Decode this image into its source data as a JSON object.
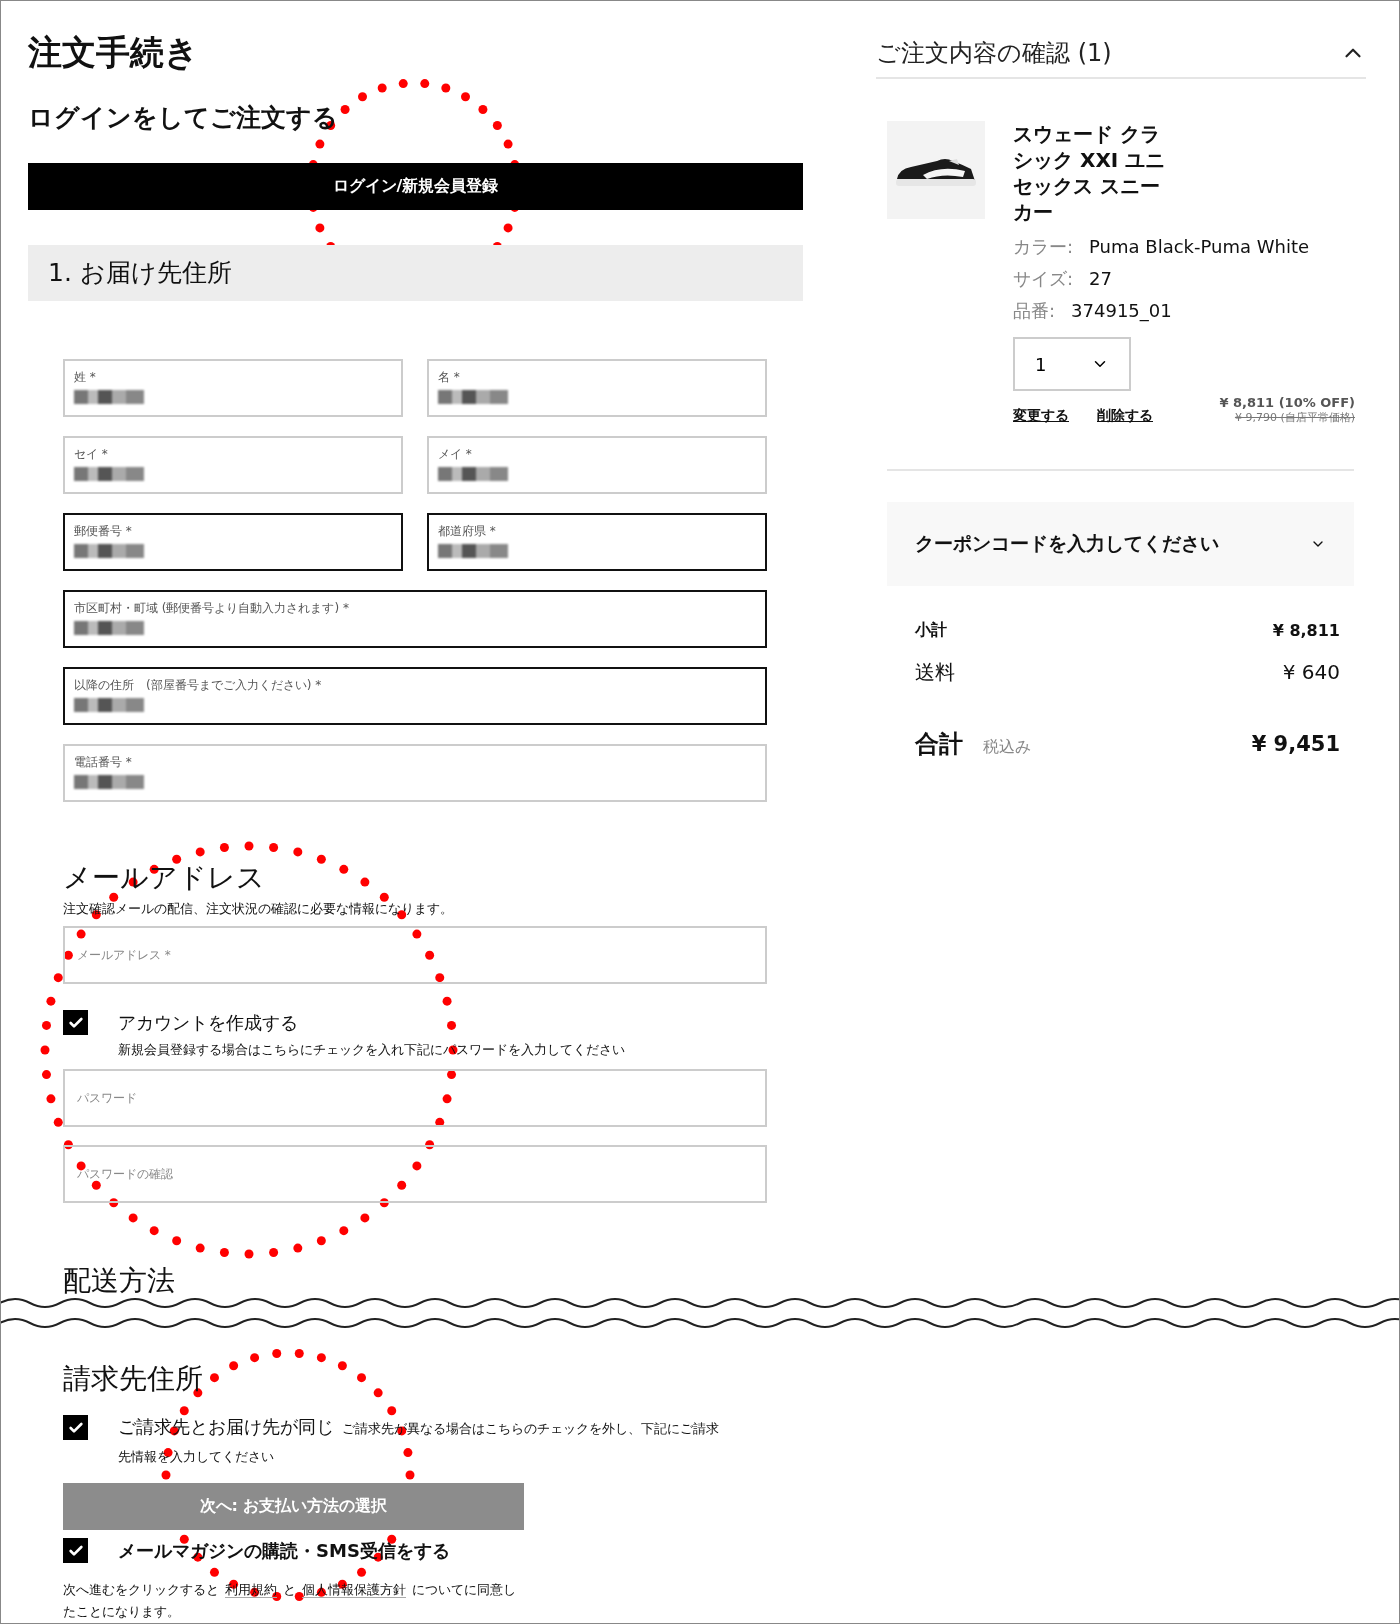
{
  "page_title": "注文手続き",
  "login": {
    "heading": "ログインをしてご注文する",
    "button": "ログイン/新規会員登録"
  },
  "shipping_address": {
    "heading": "1. お届け先住所",
    "fields": [
      {
        "label": "姓 *",
        "kind": "half",
        "outlined": false,
        "value_blurred": true
      },
      {
        "label": "名 *",
        "kind": "half",
        "outlined": false,
        "value_blurred": true
      },
      {
        "label": "セイ *",
        "kind": "half",
        "outlined": false,
        "value_blurred": true
      },
      {
        "label": "メイ *",
        "kind": "half",
        "outlined": false,
        "value_blurred": true
      },
      {
        "label": "郵便番号 *",
        "kind": "half",
        "outlined": true,
        "value_blurred": true
      },
      {
        "label": "都道府県 *",
        "kind": "half",
        "outlined": true,
        "value_blurred": true
      },
      {
        "label": "市区町村・町域 (郵便番号より自動入力されます) *",
        "kind": "full",
        "outlined": true,
        "value_blurred": true
      },
      {
        "label": "以降の住所　(部屋番号までご入力ください) *",
        "kind": "full",
        "outlined": true,
        "value_blurred": true
      },
      {
        "label": "電話番号 *",
        "kind": "full",
        "outlined": false,
        "value_blurred": true
      }
    ]
  },
  "email": {
    "heading": "メールアドレス",
    "note": "注文確認メールの配信、注文状況の確認に必要な情報になります。",
    "field": {
      "placeholder": "メールアドレス *"
    },
    "create_account": {
      "label": "アカウントを作成する",
      "checked": true,
      "hint": "新規会員登録する場合はこちらにチェックを入れ下記にパスワードを入力してください"
    },
    "password": {
      "placeholder": "パスワード"
    },
    "password_confirm": {
      "placeholder": "パスワードの確認"
    }
  },
  "shipping_method": {
    "heading": "配送方法"
  },
  "billing": {
    "heading": "請求先住所",
    "same_address": {
      "label": "ご請求先とお届け先が同じ",
      "checked": true,
      "hint_lines": [
        "ご請求先が異なる場合はこちらのチェックを外し、下記にご請求",
        "先情報を入力してください"
      ]
    },
    "next_button": {
      "label": "次へ: お支払い方法の選択",
      "disabled": true
    },
    "newsletter": {
      "label": "メールマガジンの購読・SMS受信をする",
      "checked": true
    },
    "terms": [
      {
        "kind": "text",
        "text": "次へ進むをクリックすると"
      },
      {
        "kind": "link",
        "text": "利用規約"
      },
      {
        "kind": "text",
        "text": "と"
      },
      {
        "kind": "link",
        "text": "個人情報保護方針"
      },
      {
        "kind": "text",
        "text": "についてに同意したことになります。"
      }
    ]
  },
  "order_summary": {
    "title": "ご注文内容の確認 (1)",
    "expanded": true,
    "product": {
      "name": "スウェード クラシック XXI ユニセックス スニーカー",
      "attributes": [
        {
          "label": "カラー:",
          "value": "Puma Black-Puma White"
        },
        {
          "label": "サイズ:",
          "value": "27"
        },
        {
          "label": "品番:",
          "value": "374915_01"
        }
      ],
      "quantity": "1",
      "actions": [
        "変更する",
        "削除する"
      ],
      "price": "¥ 8,811 (10% OFF)",
      "original_price": "¥ 9,790 (自店平常価格)"
    },
    "coupon": {
      "label": "クーポンコードを入力してください",
      "expanded": false
    },
    "totals": [
      {
        "kind": "subtotal",
        "label": "小計",
        "value": "¥ 8,811"
      },
      {
        "kind": "shipping",
        "label": "送料",
        "value": "¥ 640"
      },
      {
        "kind": "total",
        "label": "合計",
        "note": "税込み",
        "value": "¥ 9,451"
      }
    ]
  }
}
